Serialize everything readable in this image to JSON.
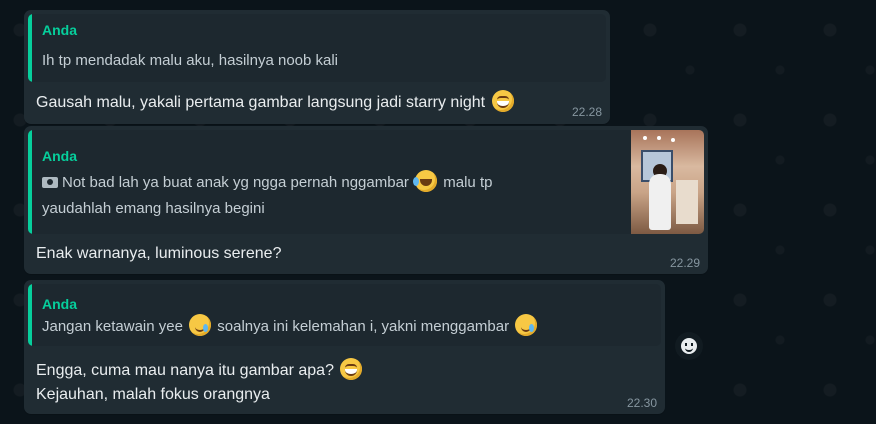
{
  "messages": [
    {
      "quote_author": "Anda",
      "quote_text": "Ih tp mendadak malu aku, hasilnya noob kali",
      "text": "Gausah malu, yakali pertama gambar langsung jadi starry night",
      "emoji": "grinning-face",
      "time": "22.28"
    },
    {
      "quote_author": "Anda",
      "quote_icon": "camera-icon",
      "quote_line1_a": "Not bad lah ya buat anak yg ngga pernah nggambar",
      "quote_emoji": "rolling-laughing-face",
      "quote_line1_b": "malu tp",
      "quote_line2": "yaudahlah emang hasilnya begini",
      "text": "Enak warnanya, luminous serene?",
      "time": "22.29"
    },
    {
      "quote_author": "Anda",
      "quote_text_a": "Jangan ketawain yee",
      "quote_emoji": "smiling-face-with-tear",
      "quote_text_b": "soalnya ini kelemahan i, yakni menggambar",
      "line1": "Engga, cuma mau nanya itu gambar apa?",
      "line1_emoji": "grinning-face",
      "line2": "Kejauhan, malah fokus orangnya",
      "time": "22.30"
    }
  ],
  "colors": {
    "background": "#0b141a",
    "bubble": "#202c33",
    "quote_accent": "#06cf9c",
    "timestamp": "#8696a0"
  },
  "react_button_icon": "emoji-react-icon"
}
